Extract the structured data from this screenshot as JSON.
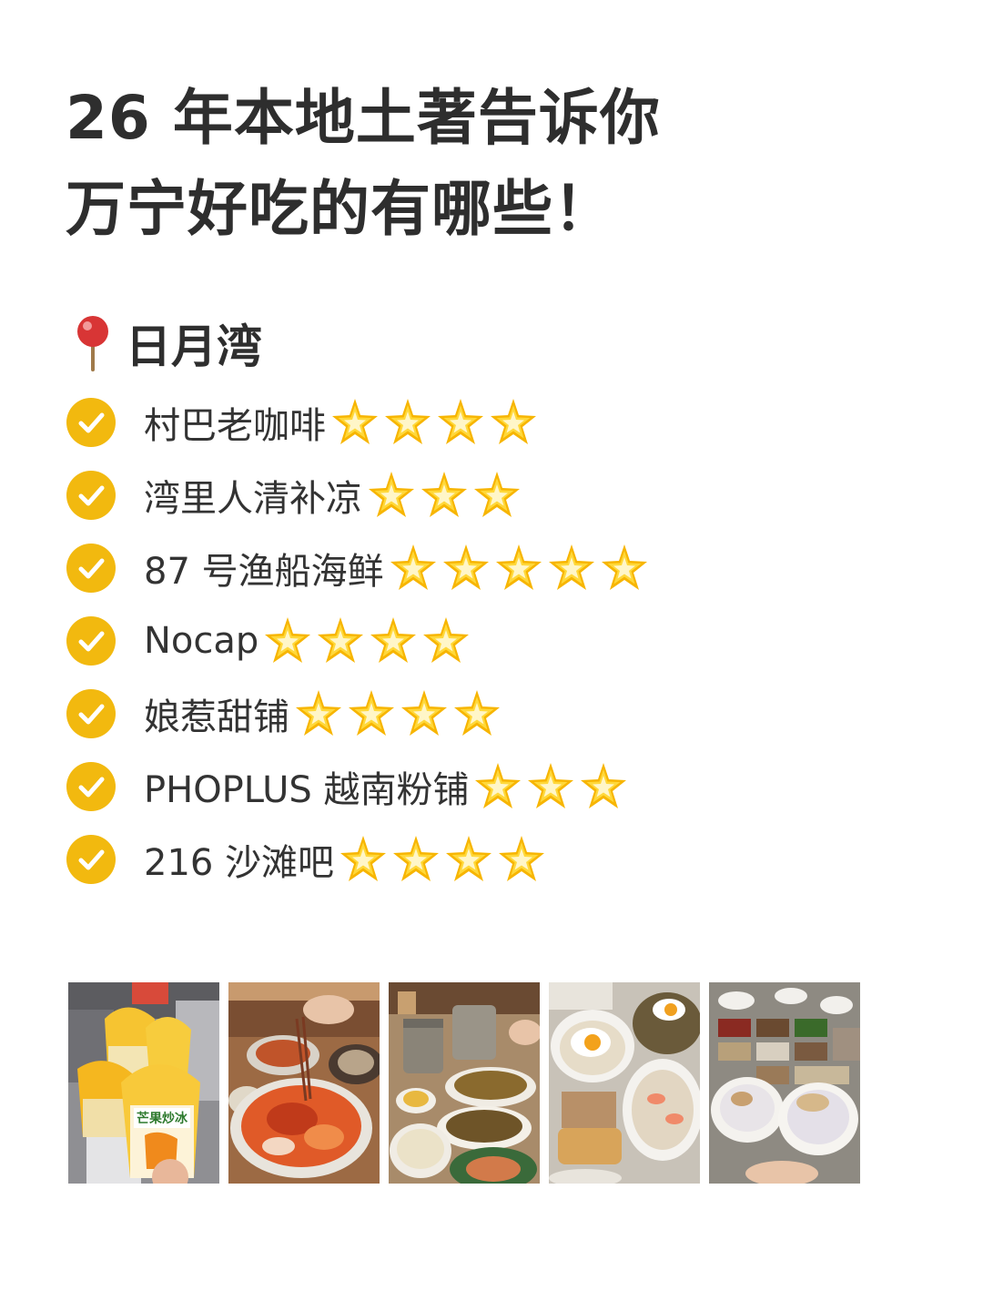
{
  "title": {
    "line1": "26 年本地土著告诉你",
    "line2": "万宁好吃的有哪些！"
  },
  "section": {
    "icon": "round-pushpin-icon",
    "title": "日月湾"
  },
  "items": [
    {
      "name": "村巴老咖啡",
      "stars": 4
    },
    {
      "name": "湾里人清补凉",
      "stars": 3
    },
    {
      "name": "87 号渔船海鲜",
      "stars": 5
    },
    {
      "name": "Nocap",
      "stars": 4
    },
    {
      "name": "娘惹甜铺",
      "stars": 4
    },
    {
      "name": "PHOPLUS 越南粉铺",
      "stars": 3
    },
    {
      "name": "216 沙滩吧",
      "stars": 4
    }
  ],
  "icons": {
    "check": "check-circle-icon",
    "star": "glowing-star-icon"
  },
  "photos": [
    {
      "label": "芒果炒冰",
      "icon": "mango-shaved-ice-photo"
    },
    {
      "icon": "seafood-crab-photo"
    },
    {
      "icon": "noodles-coffee-photo"
    },
    {
      "icon": "pho-egg-photo"
    },
    {
      "icon": "dessert-toppings-photo"
    }
  ],
  "colors": {
    "check": "#f2b90f",
    "star": "#ffd83a",
    "text": "#333333"
  }
}
